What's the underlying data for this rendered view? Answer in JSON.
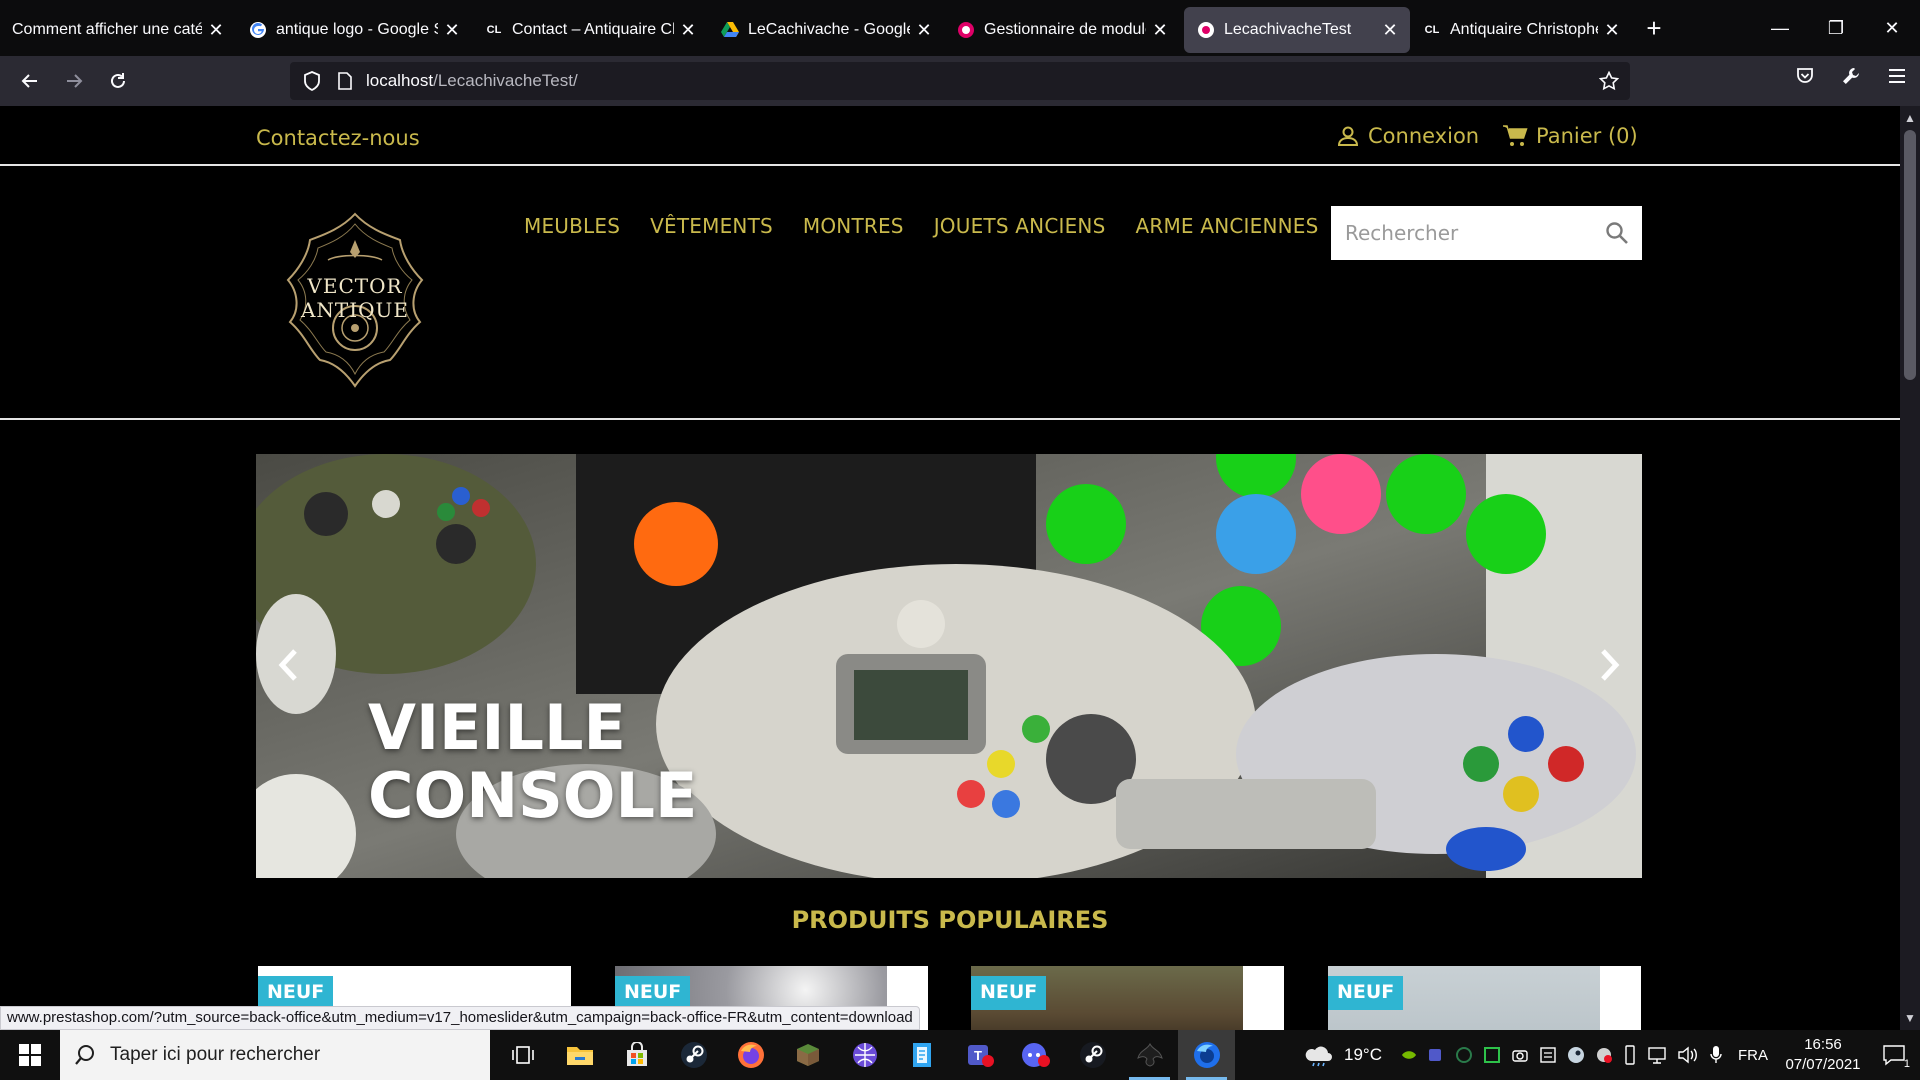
{
  "browser": {
    "tabs": [
      {
        "title": "Comment afficher une catég",
        "favicon": "none",
        "active": false
      },
      {
        "title": "antique logo - Google Se",
        "favicon": "google-g",
        "active": false
      },
      {
        "title": "Contact – Antiquaire Chr",
        "favicon": "cl-monogram",
        "favicon_text": "CL",
        "active": false
      },
      {
        "title": "LeCachivache - Google D",
        "favicon": "google-drive",
        "active": false
      },
      {
        "title": "Gestionnaire de modules",
        "favicon": "prestashop",
        "active": false
      },
      {
        "title": "LecachivacheTest",
        "favicon": "prestashop",
        "active": true
      },
      {
        "title": "Antiquaire Christophe La",
        "favicon": "cl-monogram",
        "favicon_text": "CL",
        "active": false
      }
    ],
    "url_host": "localhost",
    "url_path": "/LecachivacheTest/",
    "status_url": "www.prestashop.com/?utm_source=back-office&utm_medium=v17_homeslider&utm_campaign=back-office-FR&utm_content=download"
  },
  "site": {
    "contact_label": "Contactez-nous",
    "login_label": "Connexion",
    "cart_label": "Panier (0)",
    "logo_alt": "VECTOR ANTIQUE",
    "menu": [
      "MEUBLES",
      "VÊTEMENTS",
      "MONTRES",
      "JOUETS ANCIENS",
      "ARME ANCIENNES"
    ],
    "search_placeholder": "Rechercher",
    "slide_caption_line1": "VIEILLE",
    "slide_caption_line2": "CONSOLE",
    "section_title": "PRODUITS POPULAIRES",
    "products": [
      {
        "badge": "NEUF",
        "thumb_color": "#ffffff"
      },
      {
        "badge": "NEUF",
        "thumb_color": "#9a9aa0"
      },
      {
        "badge": "NEUF",
        "thumb_color": "#5a4a33"
      },
      {
        "badge": "NEUF",
        "thumb_color": "#b9c3c8"
      }
    ],
    "accent_color": "#c9b94c",
    "badge_color": "#2fb5d2"
  },
  "taskbar": {
    "search_placeholder": "Taper ici pour rechercher",
    "weather": "19°C",
    "language": "FRA",
    "time": "16:56",
    "date": "07/07/2021",
    "notification_count": "1"
  }
}
